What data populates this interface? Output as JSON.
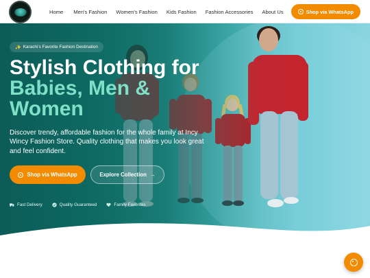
{
  "header": {
    "logo_name": "logo",
    "nav": [
      "Home",
      "Men's Fashion",
      "Women's Fashion",
      "Kids Fashion",
      "Fashion Accessories",
      "About Us"
    ],
    "cta": "Shop via WhatsApp"
  },
  "hero": {
    "badge": "Karachi's Favorite Fashion Destination",
    "title_line1": "Stylish Clothing for",
    "title_line2": "Babies, Men &",
    "title_line3": "Women",
    "lead": "Discover trendy, affordable fashion for the whole family at Incy Wincy Fashion Store. Quality clothing that makes you look great and feel confident.",
    "primary_cta": "Shop via WhatsApp",
    "secondary_cta": "Explore Collection",
    "features": [
      "Fast Delivery",
      "Quality Guaranteed",
      "Family Favorites"
    ]
  },
  "colors": {
    "accent": "#f28b00",
    "heading_highlight": "#7fe0c8",
    "hero_dark": "#0e5f5a",
    "hero_light": "#8ad6e0"
  },
  "icons": {
    "whatsapp": "whatsapp-icon",
    "sparkle": "sparkle-icon",
    "truck": "truck-icon",
    "check": "check-circle-icon",
    "heart": "heart-icon",
    "arrow": "arrow-right-icon"
  }
}
